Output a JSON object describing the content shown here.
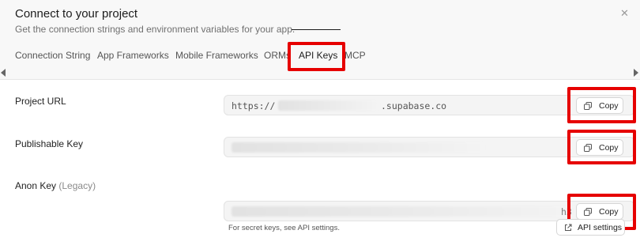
{
  "dialog": {
    "title": "Connect to your project",
    "subtitle": "Get the connection strings and environment variables for your app.",
    "close_icon": "close-icon"
  },
  "tabs": [
    {
      "label": "Connection String",
      "active": false
    },
    {
      "label": "App Frameworks",
      "active": false
    },
    {
      "label": "Mobile Frameworks",
      "active": false
    },
    {
      "label": "ORMs",
      "active": false
    },
    {
      "label": "API Keys",
      "active": true
    },
    {
      "label": "MCP",
      "active": false
    }
  ],
  "fields": {
    "project_url": {
      "label": "Project URL",
      "prefix": "https://",
      "suffix": ".supabase.co",
      "copy_label": "Copy"
    },
    "publishable_key": {
      "label": "Publishable Key",
      "copy_label": "Copy"
    },
    "anon_key": {
      "label": "Anon Key",
      "label_muted": "(Legacy)",
      "trailing_text": "h3",
      "copy_label": "Copy"
    }
  },
  "footer": {
    "note": "For secret keys, see API settings.",
    "api_settings_label": "API settings"
  },
  "colors": {
    "highlight": "#e60000",
    "header_bg": "#f8f8f8",
    "field_bg": "#f4f4f4"
  }
}
